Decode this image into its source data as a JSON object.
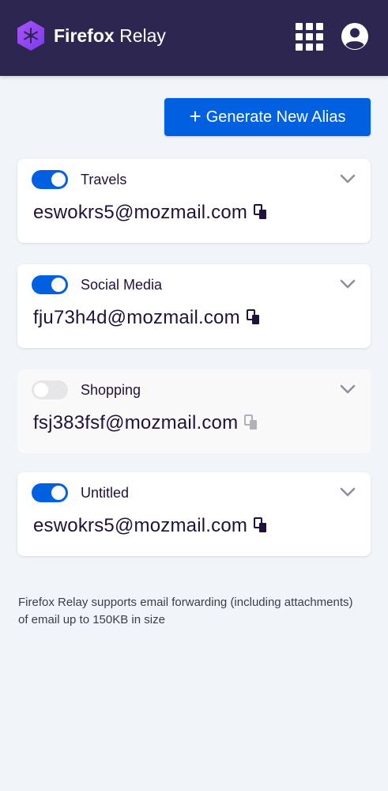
{
  "header": {
    "brand": "Firefox",
    "product": "Relay"
  },
  "toolbar": {
    "generate_label": "Generate New Alias"
  },
  "aliases": [
    {
      "label": "Travels",
      "address": "eswokrs5@mozmail.com",
      "enabled": true
    },
    {
      "label": "Social Media",
      "address": "fju73h4d@mozmail.com",
      "enabled": true
    },
    {
      "label": "Shopping",
      "address": "fsj383fsf@mozmail.com",
      "enabled": false
    },
    {
      "label": "Untitled",
      "address": "eswokrs5@mozmail.com",
      "enabled": true
    }
  ],
  "footnote": "Firefox Relay supports email forwarding (including attachments) of email up to 150KB in size",
  "colors": {
    "header_bg": "#2c2650",
    "accent": "#0060df",
    "page_bg": "#f1f4f8"
  },
  "icons": [
    "relay-logo-icon",
    "apps-grid-icon",
    "account-icon",
    "plus-icon",
    "chevron-down-icon",
    "copy-icon"
  ]
}
